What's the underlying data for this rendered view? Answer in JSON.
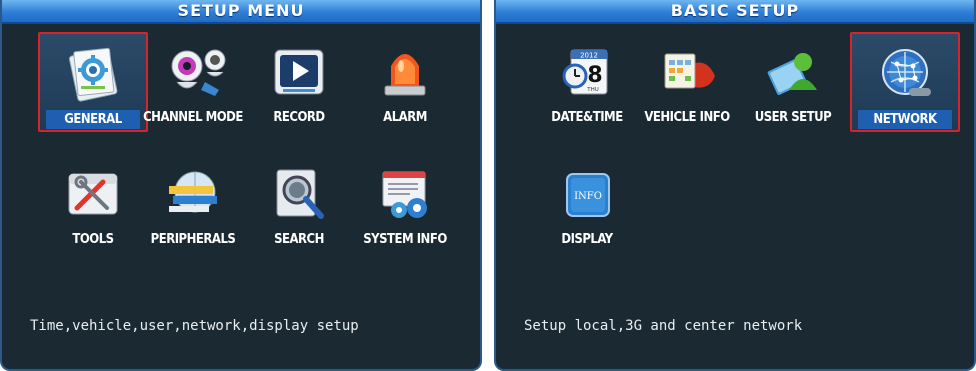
{
  "setup_menu": {
    "title": "SETUP MENU",
    "items": [
      {
        "label": "GENERAL",
        "icon": "general-gear-icon"
      },
      {
        "label": "CHANNEL MODE",
        "icon": "webcam-icon"
      },
      {
        "label": "RECORD",
        "icon": "record-play-icon"
      },
      {
        "label": "ALARM",
        "icon": "alarm-siren-icon"
      },
      {
        "label": "TOOLS",
        "icon": "tools-icon"
      },
      {
        "label": "PERIPHERALS",
        "icon": "peripherals-icon"
      },
      {
        "label": "SEARCH",
        "icon": "search-magnifier-icon"
      },
      {
        "label": "SYSTEM INFO",
        "icon": "system-info-icon"
      }
    ],
    "selected": "GENERAL",
    "status": "Time,vehicle,user,network,display setup"
  },
  "basic_setup": {
    "title": "BASIC SETUP",
    "items": [
      {
        "label": "DATE&TIME",
        "icon": "calendar-clock-icon",
        "calendar_year": "2012",
        "calendar_day": "8",
        "calendar_weekday": "THU"
      },
      {
        "label": "VEHICLE INFO",
        "icon": "vehicle-info-icon"
      },
      {
        "label": "USER SETUP",
        "icon": "user-setup-icon"
      },
      {
        "label": "NETWORK",
        "icon": "network-globe-icon"
      },
      {
        "label": "DISPLAY",
        "icon": "info-display-icon",
        "icon_text": "INFO"
      }
    ],
    "selected": "NETWORK",
    "status": "Setup local,3G and center network"
  },
  "colors": {
    "panel_bg": "#1b2a32",
    "title_bar": "#2f7fd6",
    "selection_border": "#d6242a",
    "selection_label_bg": "#1f5fb0"
  }
}
